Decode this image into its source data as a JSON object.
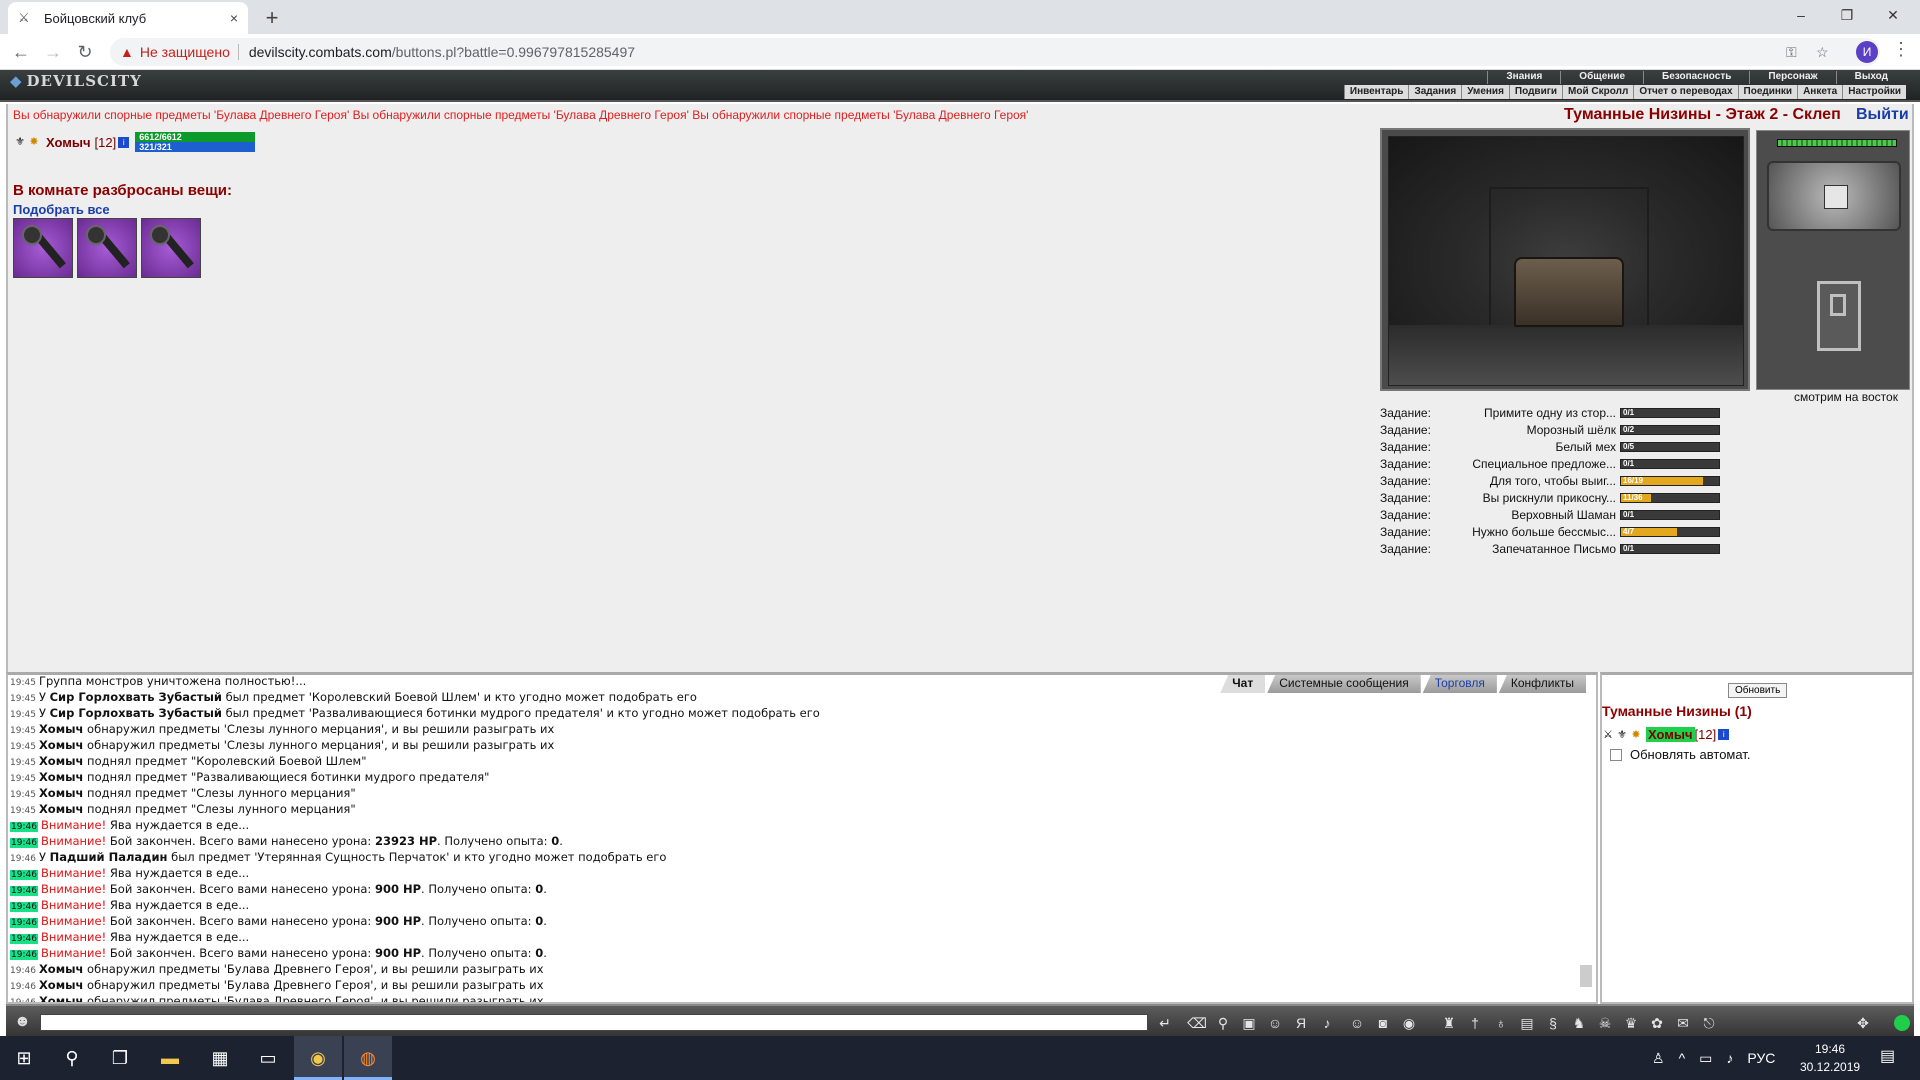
{
  "browser": {
    "tab_title": "Бойцовский клуб",
    "tab_close": "×",
    "new_tab": "+",
    "security_text": "Не защищено",
    "url_host": "devilscity.combats.com",
    "url_path": "/buttons.pl?battle=0.996797815285497",
    "avatar_letter": "И",
    "win_min": "–",
    "win_max": "❐",
    "win_close": "✕"
  },
  "game_nav": {
    "logo": "DEVILSCITY",
    "top_row": [
      "Знания",
      "Общение",
      "Безопасность",
      "Персонаж",
      "Выход"
    ],
    "bottom_row": [
      "Инвентарь",
      "Задания",
      "Умения",
      "Подвиги",
      "Мой Скролл",
      "Отчет о переводах",
      "Поединки",
      "Анкета",
      "Настройки"
    ]
  },
  "room": {
    "message": "Вы обнаружили спорные предметы 'Булава Древнего Героя' Вы обнаружили спорные предметы 'Булава Древнего Героя' Вы обнаружили спорные предметы 'Булава Древнего Героя'",
    "title": "Туманные Низины - Этаж 2 - Склеп",
    "exit": "Выйти",
    "view_direction": "смотрим на восток",
    "items_heading": "В комнате разбросаны вещи:",
    "pick_all": "Подобрать все",
    "items_count_icons": [
      "mace-icon",
      "mace-icon",
      "mace-icon"
    ]
  },
  "player": {
    "name": "Хомыч",
    "level": "[12]",
    "hp": "6612/6612",
    "mp": "321/321"
  },
  "quests": {
    "label": "Задание:",
    "items": [
      {
        "name": "Примите одну из стор...",
        "progress": "0/1",
        "fraction": 0
      },
      {
        "name": "Морозный шёлк",
        "progress": "0/2",
        "fraction": 0
      },
      {
        "name": "Белый мех",
        "progress": "0/5",
        "fraction": 0
      },
      {
        "name": "Специальное предложе...",
        "progress": "0/1",
        "fraction": 0
      },
      {
        "name": "Для того, чтобы выиг...",
        "progress": "16/19",
        "fraction": 0.84
      },
      {
        "name": "Вы рискнули прикосну...",
        "progress": "11/36",
        "fraction": 0.31
      },
      {
        "name": "Верховный Шаман",
        "progress": "0/1",
        "fraction": 0
      },
      {
        "name": "Нужно больше бессмыс...",
        "progress": "4/7",
        "fraction": 0.57
      },
      {
        "name": "Запечатанное Письмо",
        "progress": "0/1",
        "fraction": 0
      }
    ]
  },
  "chat": {
    "tabs": [
      "Чат",
      "Системные сообщения",
      "Торговля",
      "Конфликты"
    ],
    "lines": [
      {
        "t": "19:45",
        "g": false,
        "pre": "",
        "b": "",
        "warn": "",
        "rest": "Группа монстров уничтожена полностью!..."
      },
      {
        "t": "19:45",
        "g": false,
        "pre": "У ",
        "b": "Сир Горлохвать Зубастый",
        "warn": "",
        "rest": " был предмет 'Королевский Боевой Шлем' и кто угодно может подобрать его"
      },
      {
        "t": "19:45",
        "g": false,
        "pre": "У ",
        "b": "Сир Горлохвать Зубастый",
        "warn": "",
        "rest": " был предмет 'Разваливающиеся ботинки мудрого предателя' и кто угодно может подобрать его"
      },
      {
        "t": "19:45",
        "g": false,
        "pre": "",
        "b": "Хомыч",
        "warn": "",
        "rest": " обнаружил предметы 'Слезы лунного мерцания', и вы решили разыграть их"
      },
      {
        "t": "19:45",
        "g": false,
        "pre": "",
        "b": "Хомыч",
        "warn": "",
        "rest": " обнаружил предметы 'Слезы лунного мерцания', и вы решили разыграть их"
      },
      {
        "t": "19:45",
        "g": false,
        "pre": "",
        "b": "Хомыч",
        "warn": "",
        "rest": " поднял предмет \"Королевский Боевой Шлем\""
      },
      {
        "t": "19:45",
        "g": false,
        "pre": "",
        "b": "Хомыч",
        "warn": "",
        "rest": " поднял предмет \"Разваливающиеся ботинки мудрого предателя\""
      },
      {
        "t": "19:45",
        "g": false,
        "pre": "",
        "b": "Хомыч",
        "warn": "",
        "rest": " поднял предмет \"Слезы лунного мерцания\""
      },
      {
        "t": "19:45",
        "g": false,
        "pre": "",
        "b": "Хомыч",
        "warn": "",
        "rest": " поднял предмет \"Слезы лунного мерцания\""
      },
      {
        "t": "19:46",
        "g": true,
        "pre": "",
        "b": "",
        "warn": "Внимание!",
        "rest": " Ява нуждается в еде..."
      },
      {
        "t": "19:46",
        "g": true,
        "pre": "",
        "b": "",
        "warn": "Внимание!",
        "rest": " Бой закончен. Всего вами нанесено урона: ",
        "dmg": "23923 HP",
        "tail": ". Получено опыта: ",
        "xp": "0",
        "end": "."
      },
      {
        "t": "19:46",
        "g": false,
        "pre": "У ",
        "b": "Падший Паладин",
        "warn": "",
        "rest": " был предмет 'Утерянная Сущность Перчаток' и кто угодно может подобрать его"
      },
      {
        "t": "19:46",
        "g": true,
        "pre": "",
        "b": "",
        "warn": "Внимание!",
        "rest": " Ява нуждается в еде..."
      },
      {
        "t": "19:46",
        "g": true,
        "pre": "",
        "b": "",
        "warn": "Внимание!",
        "rest": " Бой закончен. Всего вами нанесено урона: ",
        "dmg": "900 HP",
        "tail": ". Получено опыта: ",
        "xp": "0",
        "end": "."
      },
      {
        "t": "19:46",
        "g": true,
        "pre": "",
        "b": "",
        "warn": "Внимание!",
        "rest": " Ява нуждается в еде..."
      },
      {
        "t": "19:46",
        "g": true,
        "pre": "",
        "b": "",
        "warn": "Внимание!",
        "rest": " Бой закончен. Всего вами нанесено урона: ",
        "dmg": "900 HP",
        "tail": ". Получено опыта: ",
        "xp": "0",
        "end": "."
      },
      {
        "t": "19:46",
        "g": true,
        "pre": "",
        "b": "",
        "warn": "Внимание!",
        "rest": " Ява нуждается в еде..."
      },
      {
        "t": "19:46",
        "g": true,
        "pre": "",
        "b": "",
        "warn": "Внимание!",
        "rest": " Бой закончен. Всего вами нанесено урона: ",
        "dmg": "900 HP",
        "tail": ". Получено опыта: ",
        "xp": "0",
        "end": "."
      },
      {
        "t": "19:46",
        "g": false,
        "pre": "",
        "b": "Хомыч",
        "warn": "",
        "rest": " обнаружил предметы 'Булава Древнего Героя', и вы решили разыграть их"
      },
      {
        "t": "19:46",
        "g": false,
        "pre": "",
        "b": "Хомыч",
        "warn": "",
        "rest": " обнаружил предметы 'Булава Древнего Героя', и вы решили разыграть их"
      },
      {
        "t": "19:46",
        "g": false,
        "pre": "",
        "b": "Хомыч",
        "warn": "",
        "rest": " обнаружил предметы 'Булава Древнего Героя', и вы решили разыграть их"
      }
    ]
  },
  "online": {
    "refresh": "Обновить",
    "title": "Туманные Низины (1)",
    "user_name": "Хомыч",
    "user_level": "[12]",
    "auto_refresh": "Обновлять автомат."
  },
  "taskbar": {
    "lang": "РУС",
    "time": "19:46",
    "date": "30.12.2019"
  }
}
